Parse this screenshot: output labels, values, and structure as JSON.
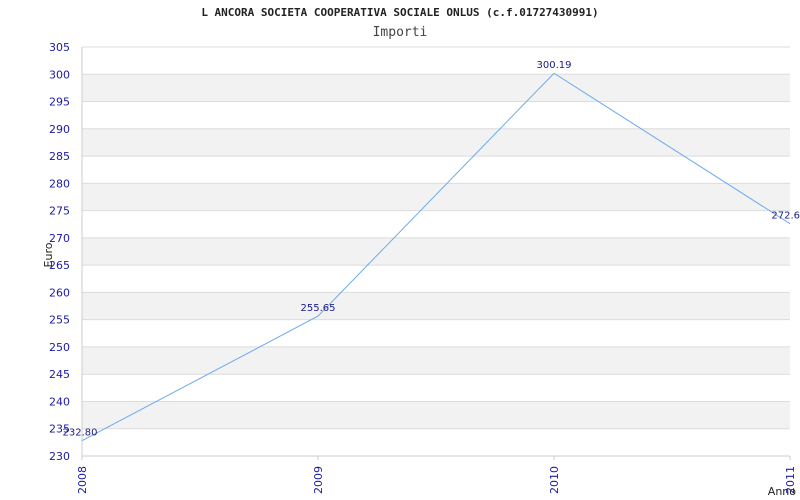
{
  "chart_data": {
    "type": "line",
    "title": "L ANCORA SOCIETA COOPERATIVA SOCIALE ONLUS (c.f.01727430991)",
    "subtitle": "Importi",
    "xlabel": "Anno",
    "ylabel": "Euro",
    "x": [
      "2008",
      "2009",
      "2010",
      "2011"
    ],
    "series": [
      {
        "values": [
          232.8,
          255.65,
          300.19,
          272.6
        ],
        "labels": [
          "232.80",
          "255.65",
          "300.19",
          "272.6"
        ]
      }
    ],
    "ylim": [
      230,
      305
    ],
    "yticks": [
      230,
      235,
      240,
      245,
      250,
      255,
      260,
      265,
      270,
      275,
      280,
      285,
      290,
      295,
      300,
      305
    ],
    "grid": true,
    "colors": {
      "line": "#6aaaf0",
      "band": "#f2f2f2",
      "tick_text": "#1a1aa6",
      "grid": "#dcdcdc"
    }
  }
}
